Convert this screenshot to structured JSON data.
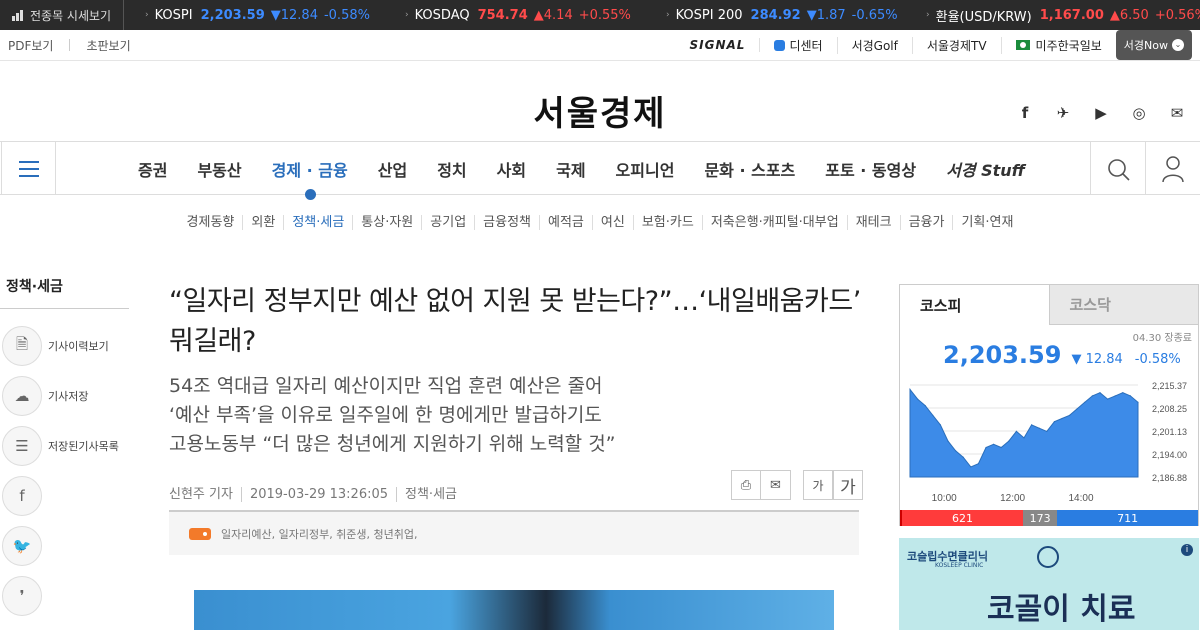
{
  "ticker": {
    "all_label": "전종목 시세보기",
    "items": [
      {
        "name": "KOSPI",
        "value": "2,203.59",
        "change": "▼12.84",
        "pct": "-0.58%",
        "dir": "down"
      },
      {
        "name": "KOSDAQ",
        "value": "754.74",
        "change": "▲4.14",
        "pct": "+0.55%",
        "dir": "up"
      },
      {
        "name": "KOSPI 200",
        "value": "284.92",
        "change": "▼1.87",
        "pct": "-0.65%",
        "dir": "down"
      },
      {
        "name": "환율(USD/KRW)",
        "value": "1,167.00",
        "change": "▲6.50",
        "pct": "+0.56%",
        "dir": "up"
      }
    ]
  },
  "util": {
    "pdf": "PDF보기",
    "chopan": "초판보기",
    "signal": "SIGNAL",
    "decenter": "디센터",
    "golf": "서경Golf",
    "tv": "서울경제TV",
    "us": "미주한국일보",
    "now": "서경Now"
  },
  "logo": "서울경제",
  "social": [
    "f",
    "✈",
    "▶",
    "◎",
    "✉"
  ],
  "gnb": {
    "items": [
      "증권",
      "부동산",
      "경제 · 금융",
      "산업",
      "정치",
      "사회",
      "국제",
      "오피니언",
      "문화 · 스포츠",
      "포토 · 동영상"
    ],
    "brand": "서경 Stuff"
  },
  "sub_nav": [
    "경제동향",
    "외환",
    "정책·세금",
    "통상·자원",
    "공기업",
    "금융정책",
    "예적금",
    "여신",
    "보험·카드",
    "저축은행·캐피털·대부업",
    "재테크",
    "금융가",
    "기획·연재"
  ],
  "left": {
    "section": "정책·세금",
    "history": "기사이력보기",
    "save": "기사저장",
    "saved_list": "저장된기사목록"
  },
  "article": {
    "title": "“일자리 정부지만 예산 없어 지원 못 받는다?”…‘내일배움카드’ 뭐길래?",
    "subtitles": [
      "54조 역대급 일자리 예산이지만 직업 훈련 예산은 줄어",
      "‘예산 부족’을 이유로 일주일에 한 명에게만 발급하기도",
      "고용노동부 “더 많은 청년에게 지원하기 위해 노력할 것”"
    ],
    "reporter": "신현주 기자",
    "datetime": "2019-03-29 13:26:05",
    "category": "정책·세금",
    "font_small": "가",
    "font_large": "가",
    "tags": "일자리예산, 일자리정부, 취준생, 청년취업,"
  },
  "widget": {
    "tab_kospi": "코스피",
    "tab_kosdaq": "코스닥",
    "date": "04.30 장종료",
    "value": "2,203.59",
    "change": "▼ 12.84",
    "pct": "-0.58%",
    "up_count": "621",
    "flat_count": "173",
    "down_count": "711",
    "accent_up": "#ff3b3b",
    "accent_down": "#2a7de1"
  },
  "chart_data": {
    "type": "area",
    "x_ticks": [
      "10:00",
      "12:00",
      "14:00"
    ],
    "y_ticks": [
      "2,215.37",
      "2,208.25",
      "2,201.13",
      "2,194.00",
      "2,186.88"
    ],
    "ylim": [
      2186.88,
      2215.37
    ],
    "x": [
      0,
      1,
      2,
      3,
      4,
      5,
      6,
      7,
      8,
      9,
      10,
      11,
      12,
      13,
      14,
      15,
      16,
      17,
      18,
      19,
      20,
      21,
      22,
      23,
      24,
      25,
      26,
      27,
      28,
      29,
      30
    ],
    "values": [
      2214,
      2211,
      2209,
      2206,
      2203,
      2198,
      2195,
      2193,
      2190,
      2191,
      2196,
      2197,
      2196,
      2198,
      2201,
      2199,
      2203,
      2202,
      2201,
      2204,
      2205,
      2206,
      2208,
      2210,
      2212,
      2213,
      2211,
      2212,
      2213,
      2212,
      2210
    ]
  },
  "ad": {
    "brand": "코슬립수면클리닉",
    "brand_en": "KOSLEEP CLINIC",
    "copy": "코골이 치료",
    "info": "i"
  }
}
